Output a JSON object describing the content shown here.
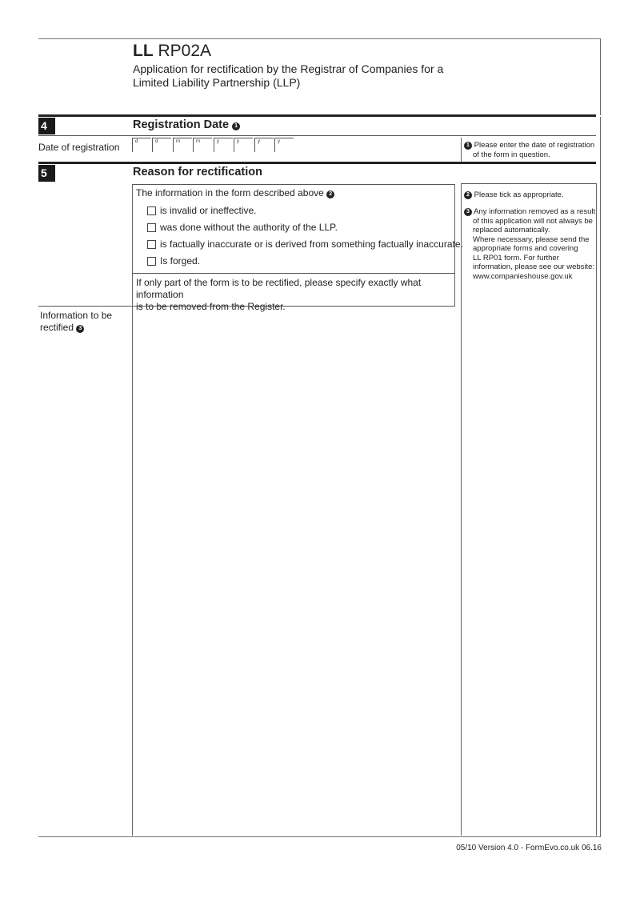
{
  "header": {
    "form_code_bold": "LL",
    "form_code": "RP02A",
    "subtitle_line1": "Application for rectification by the Registrar of Companies for a",
    "subtitle_line2": "Limited Liability Partnership (LLP)"
  },
  "section4": {
    "number": "4",
    "title": "Registration Date",
    "title_note": "1",
    "row_label": "Date of registration",
    "date_boxes": [
      "d",
      "d",
      "m",
      "m",
      "y",
      "y",
      "y",
      "y"
    ],
    "note_marker": "1",
    "note_line1": "Please enter the date of registration",
    "note_line2": "of the form in question."
  },
  "section5": {
    "number": "5",
    "title": "Reason for rectification",
    "intro": "The information in the form described above",
    "intro_note": "2",
    "options": [
      "is invalid or ineffective.",
      "was done without the authority of the LLP.",
      "is factually inaccurate or is derived from something factually inaccurate.",
      "Is forged."
    ],
    "partial_line1": "If only part of the form is to be rectified, please specify exactly what information",
    "partial_line2": "is to be removed from the Register.",
    "info_label_line1": "Information to be",
    "info_label_line2": "rectified",
    "info_note": "3",
    "note2_marker": "2",
    "note2": "Please tick as appropriate.",
    "note3_marker": "3",
    "note3_lines": [
      "Any information removed as a result",
      "of this application will not always be",
      "replaced automatically.",
      "Where necessary, please send the",
      "appropriate forms and covering",
      "LL RP01 form. For further",
      "information, please see our website:",
      "www.companieshouse.gov.uk"
    ]
  },
  "footer": {
    "version": "05/10 Version 4.0 - FormEvo.co.uk 06.16"
  }
}
